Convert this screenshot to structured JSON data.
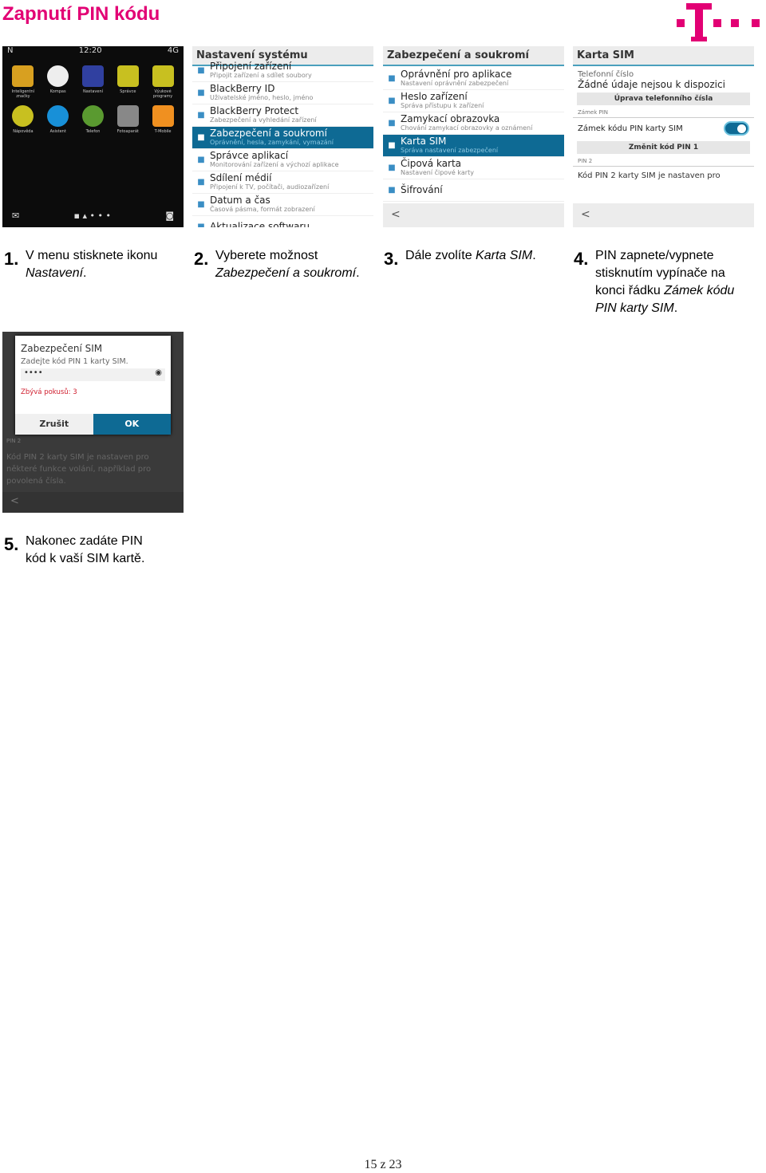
{
  "page": {
    "title": "Zapnutí PIN kódu",
    "footer": "15 z 23"
  },
  "brand": {
    "color": "#e20074",
    "logo_text": "T"
  },
  "screen1": {
    "status_left": "N",
    "time": "12:20",
    "status_right": "4G",
    "apps": [
      {
        "label": "Inteligentní značky",
        "color": "#d8a020"
      },
      {
        "label": "Kompas",
        "color": "#eeeeee"
      },
      {
        "label": "Nastavení",
        "color": "#3040a0"
      },
      {
        "label": "Správce",
        "color": "#c8c020"
      },
      {
        "label": "Výukové programy",
        "color": "#c8c020"
      },
      {
        "label": "Nápověda",
        "color": "#c8c020"
      },
      {
        "label": "Asistent",
        "color": "#1890d8"
      },
      {
        "label": "Telefon",
        "color": "#5a9a30"
      },
      {
        "label": "Fotoaparát",
        "color": "#888888"
      },
      {
        "label": "T-Mobile",
        "color": "#f09020"
      }
    ]
  },
  "screen2": {
    "header": "Nastavení systému",
    "items": [
      {
        "title": "Připojení zařízení",
        "sub": "Připojit zařízení a sdílet soubory",
        "icon": "device-icon"
      },
      {
        "title": "BlackBerry ID",
        "sub": "Uživatelské jméno, heslo, jméno",
        "icon": "id-card-icon"
      },
      {
        "title": "BlackBerry Protect",
        "sub": "Zabezpečení a vyhledání zařízení",
        "icon": "shield-icon"
      },
      {
        "title": "Zabezpečení a soukromí",
        "sub": "Oprávnění, hesla, zamykání, vymazání",
        "icon": "lock-icon",
        "selected": true
      },
      {
        "title": "Správce aplikací",
        "sub": "Monitorování zařízení a výchozí aplikace",
        "icon": "bar-chart-icon"
      },
      {
        "title": "Sdílení médií",
        "sub": "Připojení k TV, počítači, audiozařízení",
        "icon": "tv-icon"
      },
      {
        "title": "Datum a čas",
        "sub": "Časová pásma, formát zobrazení",
        "icon": "calendar-icon"
      },
      {
        "title": "Aktualizace softwaru",
        "sub": "",
        "icon": "refresh-icon"
      }
    ]
  },
  "screen3": {
    "header": "Zabezpečení a soukromí",
    "back": "<",
    "items": [
      {
        "title": "Oprávnění pro aplikace",
        "sub": "Nastavení oprávnění zabezpečení",
        "icon": "check-icon"
      },
      {
        "title": "Heslo zařízení",
        "sub": "Správa přístupu k zařízení",
        "icon": "key-icon"
      },
      {
        "title": "Zamykací obrazovka",
        "sub": "Chování zamykací obrazovky a oznámení",
        "icon": "phone-icon"
      },
      {
        "title": "Karta SIM",
        "sub": "Správa nastavení zabezpečení",
        "icon": "sim-icon",
        "selected": true
      },
      {
        "title": "Čipová karta",
        "sub": "Nastavení čipové karty",
        "icon": "smartcard-icon"
      },
      {
        "title": "Šifrování",
        "sub": "",
        "icon": "envelope-icon"
      }
    ]
  },
  "screen4": {
    "header": "Karta SIM",
    "phone_label": "Telefonní číslo",
    "phone_value": "Žádné údaje nejsou k dispozici",
    "edit_button": "Úprava telefonního čísla",
    "section_pin": "Zámek PIN",
    "pin_lock_label": "Zámek kódu PIN karty SIM",
    "pin_lock_on": true,
    "change_pin_button": "Změnit kód PIN 1",
    "section_pin2": "PIN 2",
    "pin2_text": "Kód PIN 2 karty SIM je nastaven pro",
    "back": "<"
  },
  "screen5": {
    "dialog_title": "Zabezpečení SIM",
    "prompt": "Zadejte kód PIN 1 karty SIM.",
    "pin_value": "••••",
    "attempts": "Zbývá pokusů: 3",
    "cancel": "Zrušit",
    "ok": "OK",
    "bg_text": "Kód PIN 2 karty SIM je nastaven pro některé funkce volání, například pro povolená čísla.",
    "bg_section": "PIN 2",
    "back": "<"
  },
  "steps": [
    {
      "num": "1.",
      "pre": "V menu stisknete ikonu ",
      "em": "Nastavení",
      "post": "."
    },
    {
      "num": "2.",
      "pre": "Vyberete možnost ",
      "em": "Zabezpečení a soukromí",
      "post": "."
    },
    {
      "num": "3.",
      "pre": "Dále zvolíte ",
      "em": "Karta SIM",
      "post": "."
    },
    {
      "num": "4.",
      "pre": "PIN zapnete/vypnete stisknutím vypínače na konci řádku ",
      "em": "Zámek kódu PIN karty SIM",
      "post": "."
    },
    {
      "num": "5.",
      "pre": "Nakonec zadáte PIN kód k vaší SIM kartě.",
      "em": "",
      "post": ""
    }
  ]
}
